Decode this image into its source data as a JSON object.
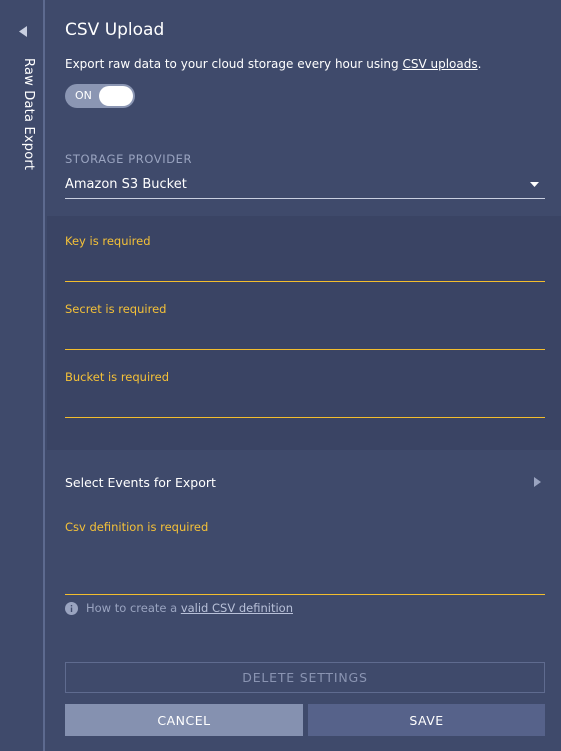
{
  "sidebar": {
    "title": "Raw Data Export",
    "collapse_icon": "triangle-left-icon"
  },
  "header": {
    "title": "CSV Upload",
    "description_prefix": "Export raw data to your cloud storage every hour using ",
    "description_link": "CSV uploads",
    "description_suffix": "."
  },
  "toggle": {
    "label": "ON",
    "state": "on"
  },
  "storage": {
    "label": "STORAGE PROVIDER",
    "value": "Amazon S3 Bucket"
  },
  "fields": [
    {
      "label": "Key is required",
      "value": ""
    },
    {
      "label": "Secret is required",
      "value": ""
    },
    {
      "label": "Bucket is required",
      "value": ""
    }
  ],
  "events": {
    "label": "Select Events for Export"
  },
  "csv": {
    "label": "Csv definition is required",
    "value": ""
  },
  "help": {
    "text": "How to create a ",
    "link": "valid CSV definition"
  },
  "actions": {
    "delete": "DELETE SETTINGS",
    "cancel": "CANCEL",
    "save": "SAVE"
  },
  "colors": {
    "background": "#3f4a6b",
    "panel": "#3a4464",
    "warning": "#f4c138",
    "muted": "#9aa4c0"
  }
}
